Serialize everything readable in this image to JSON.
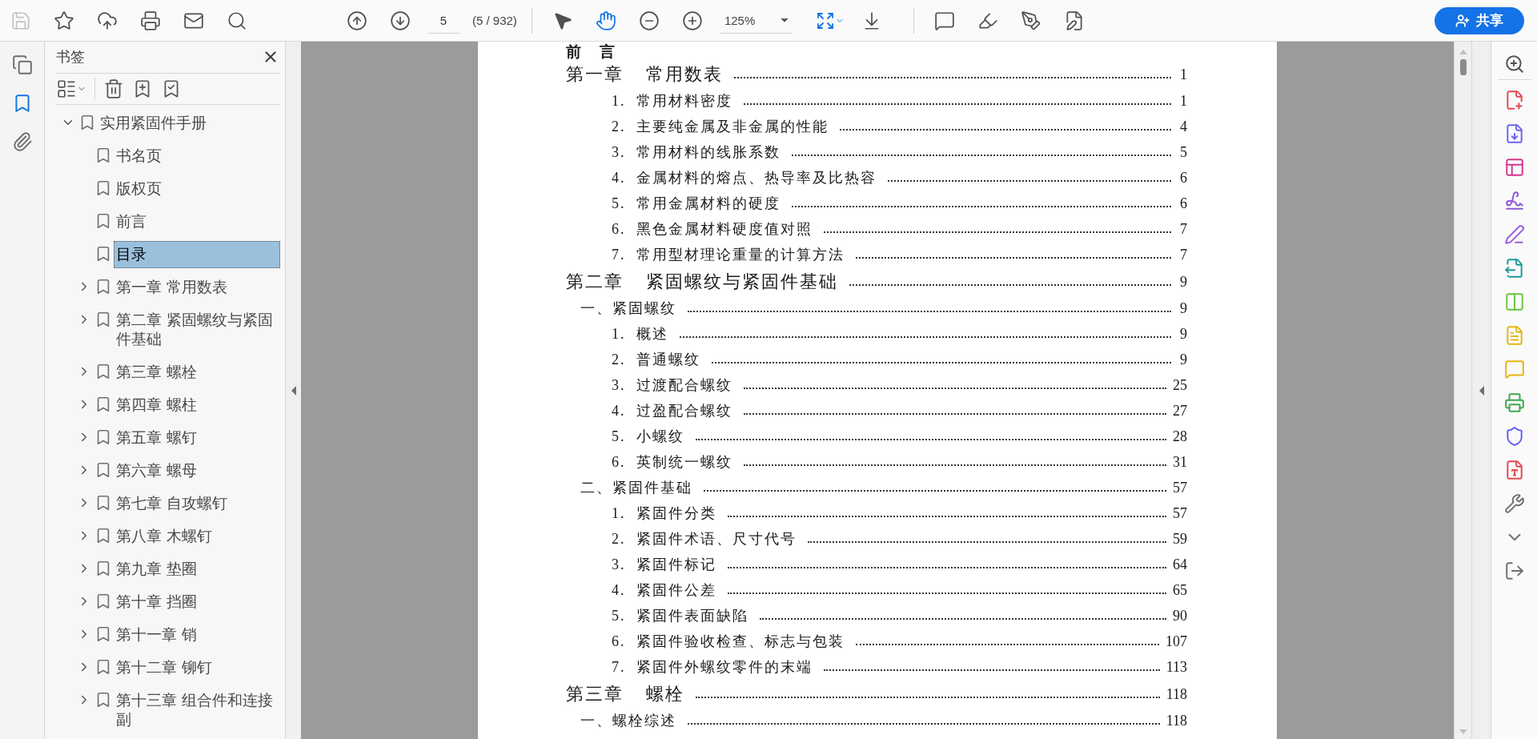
{
  "toolbar": {
    "file_actions": [
      {
        "kind": "save",
        "disabled": true
      },
      {
        "kind": "star",
        "disabled": false
      },
      {
        "kind": "upload",
        "disabled": false
      },
      {
        "kind": "print",
        "disabled": false
      },
      {
        "kind": "mail",
        "disabled": false
      },
      {
        "kind": "search",
        "disabled": false
      }
    ],
    "page_number": "5",
    "page_count": "(5 / 932)",
    "pointer_tools": [
      {
        "kind": "select",
        "selected": false
      },
      {
        "kind": "hand",
        "selected": true
      }
    ],
    "zoom": "125%",
    "share_button": "共享"
  },
  "left_rail": [
    {
      "kind": "pages",
      "selected": false
    },
    {
      "kind": "bookmarks",
      "selected": true
    },
    {
      "kind": "attachments",
      "selected": false
    }
  ],
  "bookmarks_panel": {
    "title": "书签",
    "tree": [
      {
        "label": "实用紧固件手册",
        "expanded": true,
        "selected": false,
        "children": [
          {
            "label": "书名页",
            "selected": false
          },
          {
            "label": "版权页",
            "selected": false
          },
          {
            "label": "前言",
            "selected": false
          },
          {
            "label": "目录",
            "selected": true
          },
          {
            "label": "第一章 常用数表",
            "expanded": false,
            "selected": false
          },
          {
            "label": "第二章 紧固螺纹与紧固件基础",
            "expanded": false,
            "selected": false
          },
          {
            "label": "第三章 螺栓",
            "expanded": false,
            "selected": false
          },
          {
            "label": "第四章 螺柱",
            "expanded": false,
            "selected": false
          },
          {
            "label": "第五章 螺钉",
            "expanded": false,
            "selected": false
          },
          {
            "label": "第六章 螺母",
            "expanded": false,
            "selected": false
          },
          {
            "label": "第七章 自攻螺钉",
            "expanded": false,
            "selected": false
          },
          {
            "label": "第八章 木螺钉",
            "expanded": false,
            "selected": false
          },
          {
            "label": "第九章 垫圈",
            "expanded": false,
            "selected": false
          },
          {
            "label": "第十章 挡圈",
            "expanded": false,
            "selected": false
          },
          {
            "label": "第十一章 销",
            "expanded": false,
            "selected": false
          },
          {
            "label": "第十二章 铆钉",
            "expanded": false,
            "selected": false
          },
          {
            "label": "第十三章 组合件和连接副",
            "expanded": false,
            "selected": false
          }
        ]
      }
    ]
  },
  "toc": [
    {
      "kind": "heading",
      "label": "前　言"
    },
    {
      "kind": "chapter",
      "number": "第一章",
      "title": "常用数表",
      "page": "1"
    },
    {
      "kind": "item",
      "label": "1.  常用材料密度",
      "page": "1"
    },
    {
      "kind": "item",
      "label": "2.  主要纯金属及非金属的性能",
      "page": "4"
    },
    {
      "kind": "item",
      "label": "3.  常用材料的线胀系数",
      "page": "5"
    },
    {
      "kind": "item",
      "label": "4.  金属材料的熔点、热导率及比热容",
      "page": "6"
    },
    {
      "kind": "item",
      "label": "5.  常用金属材料的硬度",
      "page": "6"
    },
    {
      "kind": "item",
      "label": "6.  黑色金属材料硬度值对照",
      "page": "7"
    },
    {
      "kind": "item",
      "label": "7.  常用型材理论重量的计算方法",
      "page": "7"
    },
    {
      "kind": "chapter",
      "number": "第二章",
      "title": "紧固螺纹与紧固件基础",
      "page": "9"
    },
    {
      "kind": "section",
      "label": "一、紧固螺纹",
      "page": "9"
    },
    {
      "kind": "item",
      "label": "1.  概述",
      "page": "9"
    },
    {
      "kind": "item",
      "label": "2.  普通螺纹",
      "page": "9"
    },
    {
      "kind": "item",
      "label": "3.  过渡配合螺纹",
      "page": "25"
    },
    {
      "kind": "item",
      "label": "4.  过盈配合螺纹",
      "page": "27"
    },
    {
      "kind": "item",
      "label": "5.  小螺纹",
      "page": "28"
    },
    {
      "kind": "item",
      "label": "6.  英制统一螺纹",
      "page": "31"
    },
    {
      "kind": "section",
      "label": "二、紧固件基础",
      "page": "57"
    },
    {
      "kind": "item",
      "label": "1.  紧固件分类",
      "page": "57"
    },
    {
      "kind": "item",
      "label": "2.  紧固件术语、尺寸代号",
      "page": "59"
    },
    {
      "kind": "item",
      "label": "3.  紧固件标记",
      "page": "64"
    },
    {
      "kind": "item",
      "label": "4.  紧固件公差",
      "page": "65"
    },
    {
      "kind": "item",
      "label": "5.  紧固件表面缺陷",
      "page": "90"
    },
    {
      "kind": "item",
      "label": "6.  紧固件验收检查、标志与包装",
      "page": "107"
    },
    {
      "kind": "item",
      "label": "7.  紧固件外螺纹零件的末端",
      "page": "113"
    },
    {
      "kind": "chapter",
      "number": "第三章",
      "title": "螺栓",
      "page": "118"
    },
    {
      "kind": "section",
      "label": "一、螺栓综述",
      "page": "118"
    }
  ],
  "right_rail": [
    {
      "kind": "zoom",
      "color": "#505050"
    },
    {
      "kind": "create",
      "color": "#e34850"
    },
    {
      "kind": "export",
      "color": "#6c63ee"
    },
    {
      "kind": "layout",
      "color": "#d83790"
    },
    {
      "kind": "signature",
      "color": "#8b55d8"
    },
    {
      "kind": "sign",
      "color": "#9a5ce0"
    },
    {
      "kind": "send",
      "color": "#1a9a9c"
    },
    {
      "kind": "organize",
      "color": "#6ac43f"
    },
    {
      "kind": "note",
      "color": "#e2b714"
    },
    {
      "kind": "comment",
      "color": "#e2b714"
    },
    {
      "kind": "print",
      "color": "#3da74e"
    },
    {
      "kind": "protect",
      "color": "#6161ee"
    },
    {
      "kind": "pdf",
      "color": "#e34850"
    },
    {
      "kind": "tools",
      "color": "#6e6e6e"
    },
    {
      "kind": "more",
      "color": "#6e6e6e"
    },
    {
      "kind": "exit",
      "color": "#6e6e6e"
    }
  ]
}
